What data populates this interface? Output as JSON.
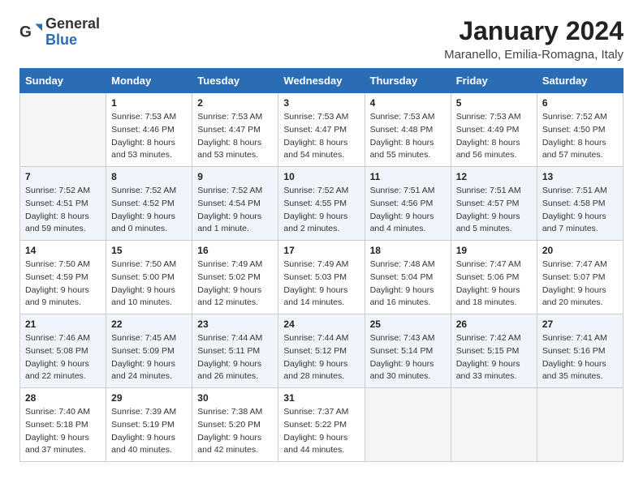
{
  "header": {
    "logo_general": "General",
    "logo_blue": "Blue",
    "title": "January 2024",
    "subtitle": "Maranello, Emilia-Romagna, Italy"
  },
  "days_of_week": [
    "Sunday",
    "Monday",
    "Tuesday",
    "Wednesday",
    "Thursday",
    "Friday",
    "Saturday"
  ],
  "weeks": [
    [
      {
        "day": "",
        "info": []
      },
      {
        "day": "1",
        "info": [
          "Sunrise: 7:53 AM",
          "Sunset: 4:46 PM",
          "Daylight: 8 hours",
          "and 53 minutes."
        ]
      },
      {
        "day": "2",
        "info": [
          "Sunrise: 7:53 AM",
          "Sunset: 4:47 PM",
          "Daylight: 8 hours",
          "and 53 minutes."
        ]
      },
      {
        "day": "3",
        "info": [
          "Sunrise: 7:53 AM",
          "Sunset: 4:47 PM",
          "Daylight: 8 hours",
          "and 54 minutes."
        ]
      },
      {
        "day": "4",
        "info": [
          "Sunrise: 7:53 AM",
          "Sunset: 4:48 PM",
          "Daylight: 8 hours",
          "and 55 minutes."
        ]
      },
      {
        "day": "5",
        "info": [
          "Sunrise: 7:53 AM",
          "Sunset: 4:49 PM",
          "Daylight: 8 hours",
          "and 56 minutes."
        ]
      },
      {
        "day": "6",
        "info": [
          "Sunrise: 7:52 AM",
          "Sunset: 4:50 PM",
          "Daylight: 8 hours",
          "and 57 minutes."
        ]
      }
    ],
    [
      {
        "day": "7",
        "info": [
          "Sunrise: 7:52 AM",
          "Sunset: 4:51 PM",
          "Daylight: 8 hours",
          "and 59 minutes."
        ]
      },
      {
        "day": "8",
        "info": [
          "Sunrise: 7:52 AM",
          "Sunset: 4:52 PM",
          "Daylight: 9 hours",
          "and 0 minutes."
        ]
      },
      {
        "day": "9",
        "info": [
          "Sunrise: 7:52 AM",
          "Sunset: 4:54 PM",
          "Daylight: 9 hours",
          "and 1 minute."
        ]
      },
      {
        "day": "10",
        "info": [
          "Sunrise: 7:52 AM",
          "Sunset: 4:55 PM",
          "Daylight: 9 hours",
          "and 2 minutes."
        ]
      },
      {
        "day": "11",
        "info": [
          "Sunrise: 7:51 AM",
          "Sunset: 4:56 PM",
          "Daylight: 9 hours",
          "and 4 minutes."
        ]
      },
      {
        "day": "12",
        "info": [
          "Sunrise: 7:51 AM",
          "Sunset: 4:57 PM",
          "Daylight: 9 hours",
          "and 5 minutes."
        ]
      },
      {
        "day": "13",
        "info": [
          "Sunrise: 7:51 AM",
          "Sunset: 4:58 PM",
          "Daylight: 9 hours",
          "and 7 minutes."
        ]
      }
    ],
    [
      {
        "day": "14",
        "info": [
          "Sunrise: 7:50 AM",
          "Sunset: 4:59 PM",
          "Daylight: 9 hours",
          "and 9 minutes."
        ]
      },
      {
        "day": "15",
        "info": [
          "Sunrise: 7:50 AM",
          "Sunset: 5:00 PM",
          "Daylight: 9 hours",
          "and 10 minutes."
        ]
      },
      {
        "day": "16",
        "info": [
          "Sunrise: 7:49 AM",
          "Sunset: 5:02 PM",
          "Daylight: 9 hours",
          "and 12 minutes."
        ]
      },
      {
        "day": "17",
        "info": [
          "Sunrise: 7:49 AM",
          "Sunset: 5:03 PM",
          "Daylight: 9 hours",
          "and 14 minutes."
        ]
      },
      {
        "day": "18",
        "info": [
          "Sunrise: 7:48 AM",
          "Sunset: 5:04 PM",
          "Daylight: 9 hours",
          "and 16 minutes."
        ]
      },
      {
        "day": "19",
        "info": [
          "Sunrise: 7:47 AM",
          "Sunset: 5:06 PM",
          "Daylight: 9 hours",
          "and 18 minutes."
        ]
      },
      {
        "day": "20",
        "info": [
          "Sunrise: 7:47 AM",
          "Sunset: 5:07 PM",
          "Daylight: 9 hours",
          "and 20 minutes."
        ]
      }
    ],
    [
      {
        "day": "21",
        "info": [
          "Sunrise: 7:46 AM",
          "Sunset: 5:08 PM",
          "Daylight: 9 hours",
          "and 22 minutes."
        ]
      },
      {
        "day": "22",
        "info": [
          "Sunrise: 7:45 AM",
          "Sunset: 5:09 PM",
          "Daylight: 9 hours",
          "and 24 minutes."
        ]
      },
      {
        "day": "23",
        "info": [
          "Sunrise: 7:44 AM",
          "Sunset: 5:11 PM",
          "Daylight: 9 hours",
          "and 26 minutes."
        ]
      },
      {
        "day": "24",
        "info": [
          "Sunrise: 7:44 AM",
          "Sunset: 5:12 PM",
          "Daylight: 9 hours",
          "and 28 minutes."
        ]
      },
      {
        "day": "25",
        "info": [
          "Sunrise: 7:43 AM",
          "Sunset: 5:14 PM",
          "Daylight: 9 hours",
          "and 30 minutes."
        ]
      },
      {
        "day": "26",
        "info": [
          "Sunrise: 7:42 AM",
          "Sunset: 5:15 PM",
          "Daylight: 9 hours",
          "and 33 minutes."
        ]
      },
      {
        "day": "27",
        "info": [
          "Sunrise: 7:41 AM",
          "Sunset: 5:16 PM",
          "Daylight: 9 hours",
          "and 35 minutes."
        ]
      }
    ],
    [
      {
        "day": "28",
        "info": [
          "Sunrise: 7:40 AM",
          "Sunset: 5:18 PM",
          "Daylight: 9 hours",
          "and 37 minutes."
        ]
      },
      {
        "day": "29",
        "info": [
          "Sunrise: 7:39 AM",
          "Sunset: 5:19 PM",
          "Daylight: 9 hours",
          "and 40 minutes."
        ]
      },
      {
        "day": "30",
        "info": [
          "Sunrise: 7:38 AM",
          "Sunset: 5:20 PM",
          "Daylight: 9 hours",
          "and 42 minutes."
        ]
      },
      {
        "day": "31",
        "info": [
          "Sunrise: 7:37 AM",
          "Sunset: 5:22 PM",
          "Daylight: 9 hours",
          "and 44 minutes."
        ]
      },
      {
        "day": "",
        "info": []
      },
      {
        "day": "",
        "info": []
      },
      {
        "day": "",
        "info": []
      }
    ]
  ]
}
